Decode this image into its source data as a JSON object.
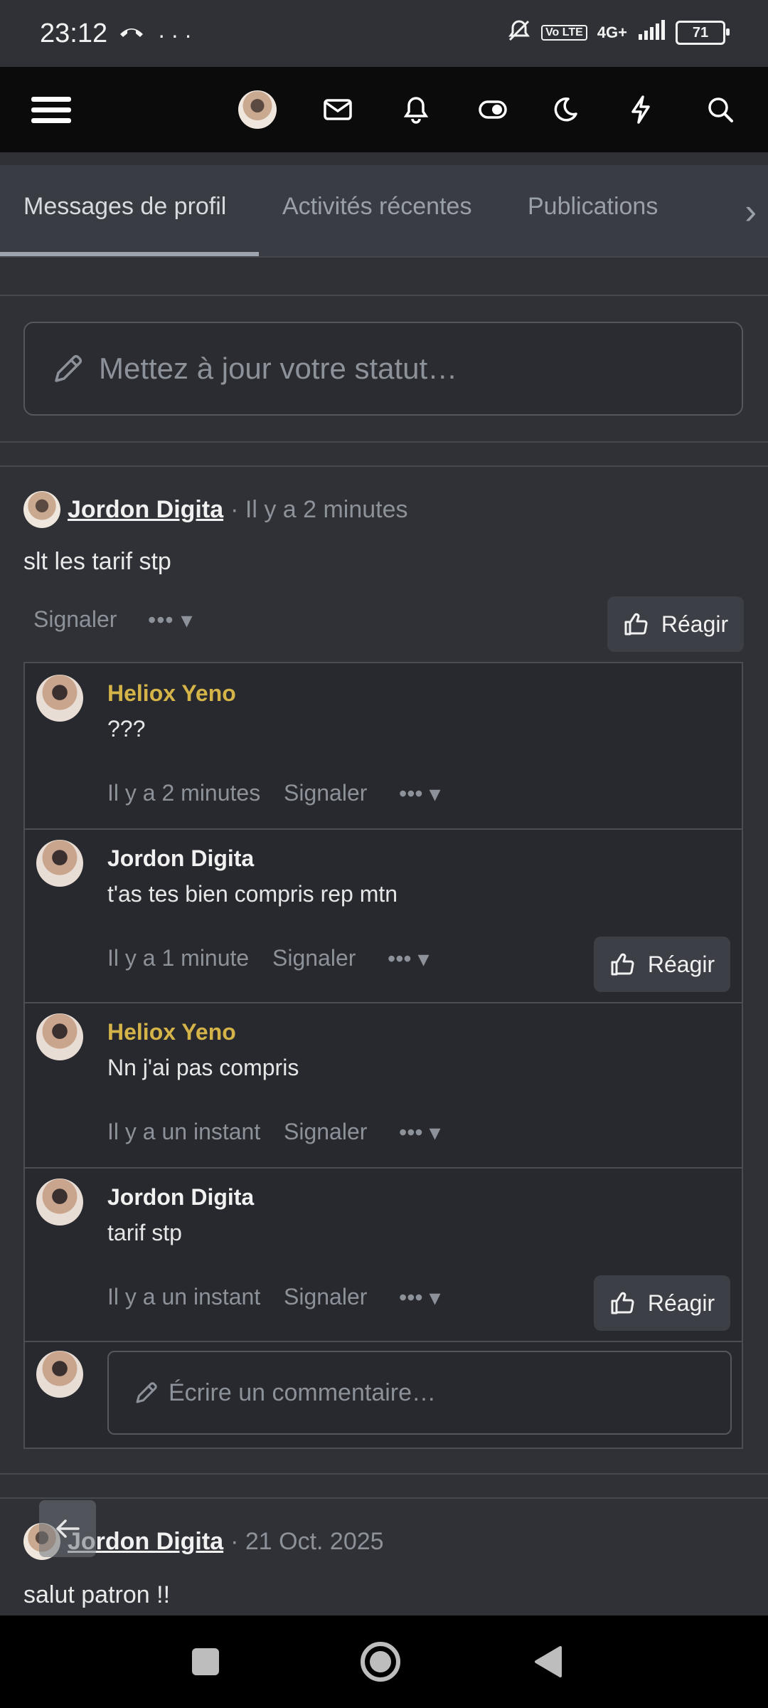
{
  "status_bar": {
    "time": "23:12",
    "extra_icons": "···",
    "lte_label": "Vo LTE",
    "network": "4G+",
    "battery": "71"
  },
  "top_nav": {
    "icons": [
      "menu-icon",
      "avatar",
      "mail-icon",
      "bell-icon",
      "toggle-icon",
      "moon-icon",
      "bolt-icon",
      "search-icon"
    ]
  },
  "tabs": {
    "items": [
      {
        "label": "Messages de profil",
        "active": true
      },
      {
        "label": "Activités récentes",
        "active": false
      },
      {
        "label": "Publications",
        "active": false
      }
    ]
  },
  "status_input": {
    "placeholder": "Mettez à jour votre statut…"
  },
  "post1": {
    "author": "Jordon Digita",
    "time": "· Il y a 2 minutes",
    "body": "slt les tarif stp",
    "report_label": "Signaler",
    "more_label": "•••",
    "react_label": "Réagir"
  },
  "comments": [
    {
      "author": "Heliox Yeno",
      "author_color": "#d4b348",
      "text": "???",
      "time": "Il y a 2 minutes",
      "report": "Signaler",
      "more": "•••",
      "react": ""
    },
    {
      "author": "Jordon Digita",
      "author_color": "#f1f1f1",
      "text": "t'as tes bien compris rep mtn",
      "time": "Il y a 1 minute",
      "report": "Signaler",
      "more": "•••",
      "react": "Réagir"
    },
    {
      "author": "Heliox Yeno",
      "author_color": "#d4b348",
      "text": "Nn j'ai pas compris",
      "time": "Il y a un instant",
      "report": "Signaler",
      "more": "•••",
      "react": ""
    },
    {
      "author": "Jordon Digita",
      "author_color": "#f1f1f1",
      "text": "tarif stp",
      "time": "Il y a un instant",
      "report": "Signaler",
      "more": "•••",
      "react": "Réagir"
    }
  ],
  "comment_input": {
    "placeholder": "Écrire un commentaire…"
  },
  "post2": {
    "author": "Jordon Digita",
    "time": "· 21 Oct. 2025",
    "body": "salut patron !!"
  },
  "colors": {
    "background": "#2f3136",
    "nav_background": "#0b0b0c",
    "accent_yellow": "#d4b348"
  }
}
